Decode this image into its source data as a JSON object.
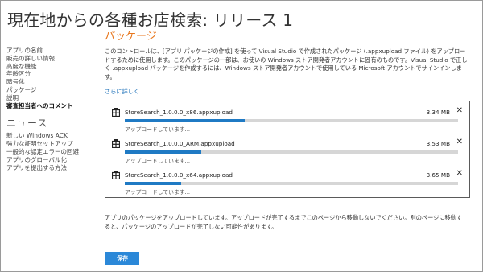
{
  "page": {
    "title": "現在地からの各種お店検索: リリース 1"
  },
  "sidebar": {
    "items": [
      {
        "label": "アプリの名前"
      },
      {
        "label": "販売の詳しい情報"
      },
      {
        "label": "高度な機能"
      },
      {
        "label": "年齢区分"
      },
      {
        "label": "暗号化"
      },
      {
        "label": "パッケージ"
      },
      {
        "label": "説明"
      },
      {
        "label": "審査担当者へのコメント"
      }
    ],
    "active_index": 7,
    "news_heading": "ニュース",
    "news_items": [
      {
        "label": "新しい Windows ACK"
      },
      {
        "label": "強力な証明セットアップ"
      },
      {
        "label": "一般的な認定エラーの回避"
      },
      {
        "label": "アプリのグローバル化"
      },
      {
        "label": "アプリを提出する方法"
      }
    ]
  },
  "main": {
    "section_title": "パッケージ",
    "description": "このコントロールは、[アプリ パッケージの作成] を使って Visual Studio で作成されたパッケージ (.appxupload ファイル) をアップロードするために使用します。このパッケージの一部は、お使いの Windows ストア開発者アカウントに固有のものです。Visual Studio で正しく .appxupload パッケージを作成するには、Windows ストア開発者アカウントで使用している Microsoft アカウントでサインインします。",
    "learn_more": "さらに詳しく"
  },
  "uploads": [
    {
      "file_name": "StoreSearch_1.0.0.0_x86.appxupload",
      "size": "3.34 MB",
      "progress": 0.36,
      "status": "アップロードしています..."
    },
    {
      "file_name": "StoreSearch_1.0.0.0_ARM.appxupload",
      "size": "3.53 MB",
      "progress": 0.23,
      "status": "アップロードしています..."
    },
    {
      "file_name": "StoreSearch_1.0.0.0_x64.appxupload",
      "size": "3.65 MB",
      "progress": 0.17,
      "status": "アップロードしています..."
    }
  ],
  "footer": {
    "note": "アプリのパッケージをアップロードしています。アップロードが完了するまでこのページから移動しないでください。別のページに移動すると、パッケージのアップロードが完了しない可能性があります。",
    "save_label": "保存"
  },
  "colors": {
    "accent": "#e8761c",
    "link": "#1a6fb8",
    "progress": "#1f7ac4",
    "button": "#2b88d8"
  },
  "icons": {
    "package": "package-icon",
    "close": "close-icon"
  }
}
